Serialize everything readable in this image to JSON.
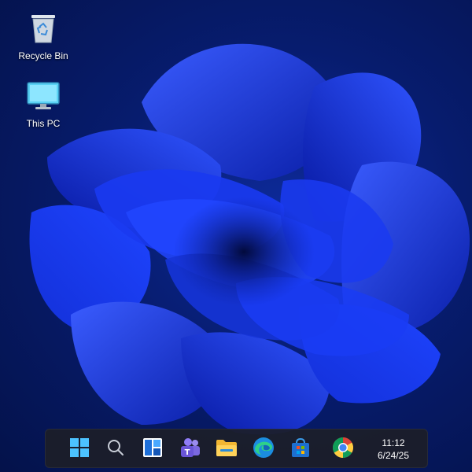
{
  "desktop": {
    "icons": [
      {
        "label": "Recycle Bin",
        "icon": "recycle-bin-icon"
      },
      {
        "label": "This PC",
        "icon": "monitor-icon"
      }
    ]
  },
  "taskbar": {
    "buttons": [
      {
        "name": "start",
        "icon": "windows-logo-icon"
      },
      {
        "name": "search",
        "icon": "search-icon"
      },
      {
        "name": "widgets",
        "icon": "widgets-icon"
      },
      {
        "name": "teams",
        "icon": "teams-icon"
      },
      {
        "name": "file-explorer",
        "icon": "folder-icon"
      },
      {
        "name": "edge",
        "icon": "edge-browser-icon"
      },
      {
        "name": "store",
        "icon": "store-icon"
      },
      {
        "name": "chrome",
        "icon": "chrome-browser-icon"
      }
    ],
    "clock": {
      "time": "11:12",
      "date": "6/24/25"
    }
  },
  "colors": {
    "wallpaper_bg": "#061a63",
    "bloom_blue": "#1f3fe0",
    "taskbar_bg": "#1c1e28",
    "start_blue": "#4cc2ff"
  }
}
